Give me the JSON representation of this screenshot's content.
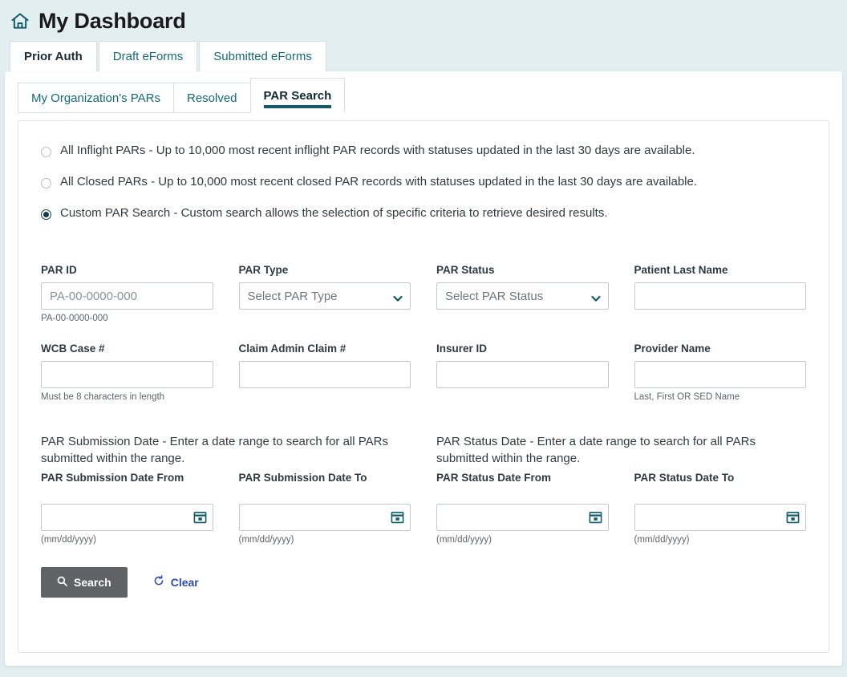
{
  "header": {
    "title": "My Dashboard",
    "home_icon": "home-icon"
  },
  "outer_tabs": [
    {
      "label": "Prior Auth",
      "active": true
    },
    {
      "label": "Draft eForms",
      "active": false
    },
    {
      "label": "Submitted eForms",
      "active": false
    }
  ],
  "inner_tabs": [
    {
      "label": "My Organization's PARs",
      "active": false
    },
    {
      "label": "Resolved",
      "active": false
    },
    {
      "label": "PAR Search",
      "active": true
    }
  ],
  "search_mode_options": [
    {
      "label": "All Inflight PARs - Up to 10,000 most recent inflight PAR records with statuses updated in the last 30 days are available.",
      "selected": false
    },
    {
      "label": "All Closed PARs - Up to 10,000 most recent closed PAR records with statuses updated in the last 30 days are available.",
      "selected": false
    },
    {
      "label": "Custom PAR Search - Custom search allows the selection of specific criteria to retrieve desired results.",
      "selected": true
    }
  ],
  "fields": {
    "par_id": {
      "label": "PAR ID",
      "placeholder": "PA-00-0000-000",
      "value": "",
      "hint": "PA-00-0000-000"
    },
    "par_type": {
      "label": "PAR Type",
      "selected": "Select PAR Type",
      "hint": ""
    },
    "par_status": {
      "label": "PAR Status",
      "selected": "Select PAR Status",
      "hint": ""
    },
    "patient_last_name": {
      "label": "Patient Last Name",
      "placeholder": "",
      "value": "",
      "hint": ""
    },
    "wcb_case": {
      "label": "WCB Case #",
      "placeholder": "",
      "value": "",
      "hint": "Must be 8 characters in length"
    },
    "claim_admin_claim": {
      "label": "Claim Admin Claim #",
      "placeholder": "",
      "value": "",
      "hint": ""
    },
    "insurer_id": {
      "label": "Insurer ID",
      "placeholder": "",
      "value": "",
      "hint": ""
    },
    "provider_name": {
      "label": "Provider Name",
      "placeholder": "",
      "value": "",
      "hint": "Last, First OR SED Name"
    }
  },
  "date_section": {
    "submission_intro": "PAR Submission Date - Enter a date range to search for all PARs submitted within the range.",
    "status_intro": "PAR Status Date - Enter a date range to search for all PARs submitted within the range.",
    "submission_from": {
      "label": "PAR Submission Date From",
      "value": "",
      "hint": "(mm/dd/yyyy)"
    },
    "submission_to": {
      "label": "PAR Submission Date To",
      "value": "",
      "hint": "(mm/dd/yyyy)"
    },
    "status_from": {
      "label": "PAR Status Date From",
      "value": "",
      "hint": "(mm/dd/yyyy)"
    },
    "status_to": {
      "label": "PAR Status Date To",
      "value": "",
      "hint": "(mm/dd/yyyy)"
    }
  },
  "actions": {
    "search_label": "Search",
    "clear_label": "Clear"
  },
  "colors": {
    "page_background": "#e3eef0",
    "teal": "#0f5a6b",
    "link_teal": "#14697a",
    "search_button": "#5f6365",
    "clear_link": "#2b4bb5",
    "radio_selected": "#123b4a"
  }
}
